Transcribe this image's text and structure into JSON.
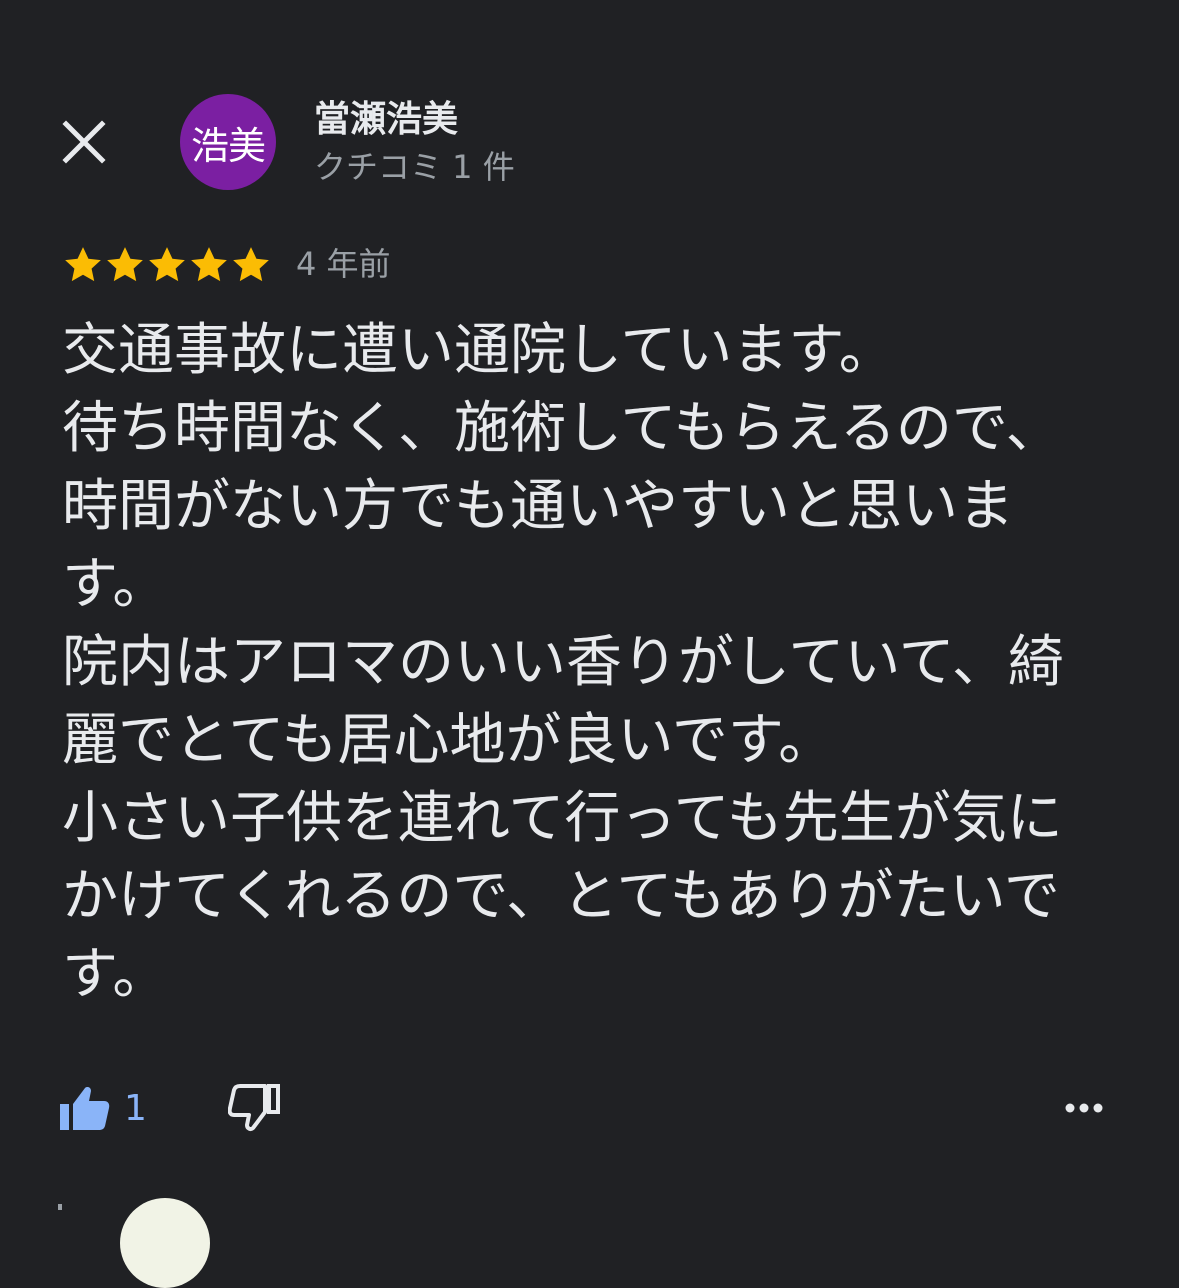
{
  "header": {
    "close_icon": "close-icon",
    "avatar_text": "浩美",
    "avatar_color": "#7b1fa2",
    "author_name": "當瀬浩美",
    "review_count": "クチコミ 1 件"
  },
  "rating": {
    "stars": 5,
    "max": 5,
    "star_color": "#fbbc04",
    "time_ago": "4 年前"
  },
  "review": {
    "paragraphs": [
      "交通事故に遭い通院しています。",
      "待ち時間なく、施術してもらえるので、時間がない方でも通いやすいと思います。",
      "院内はアロマのいい香りがしていて、綺麗でとても居心地が良いです。",
      "小さい子供を連れて行っても先生が気にかけてくれるので、とてもありがたいです。"
    ]
  },
  "actions": {
    "like_icon": "thumbs-up-filled-icon",
    "like_count": "1",
    "like_color": "#8ab4f8",
    "dislike_icon": "thumbs-down-outline-icon",
    "more_icon": "more-horizontal-icon"
  }
}
